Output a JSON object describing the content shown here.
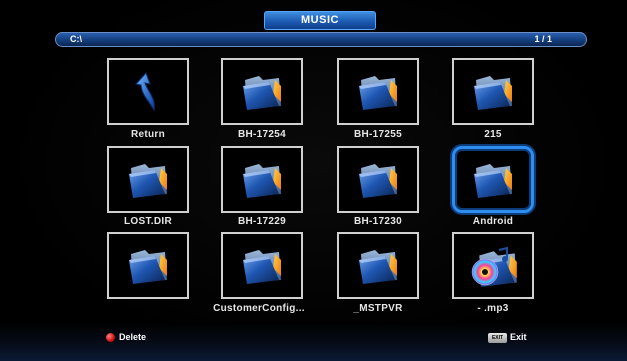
{
  "header": {
    "title": "MUSIC"
  },
  "path_bar": {
    "path": "C:\\",
    "page": "1 / 1"
  },
  "items": [
    {
      "label": "Return",
      "icon": "return-arrow-icon"
    },
    {
      "label": "BH-17254",
      "icon": "folder-icon"
    },
    {
      "label": "BH-17255",
      "icon": "folder-icon"
    },
    {
      "label": "215",
      "icon": "folder-icon"
    },
    {
      "label": "LOST.DIR",
      "icon": "folder-icon"
    },
    {
      "label": "BH-17229",
      "icon": "folder-icon"
    },
    {
      "label": "BH-17230",
      "icon": "folder-icon"
    },
    {
      "label": "Android",
      "icon": "folder-icon",
      "selected": true
    },
    {
      "label": "",
      "icon": "folder-icon"
    },
    {
      "label": "CustomerConfig...",
      "icon": "folder-icon"
    },
    {
      "label": "_MSTPVR",
      "icon": "folder-icon"
    },
    {
      "label": "- .mp3",
      "icon": "music-file-icon"
    }
  ],
  "footer": {
    "delete_label": "Delete",
    "exit_key": "EXIT",
    "exit_label": "Exit"
  },
  "colors": {
    "accent": "#2f8df0",
    "background": "#000000",
    "delete_button": "#d01010"
  }
}
